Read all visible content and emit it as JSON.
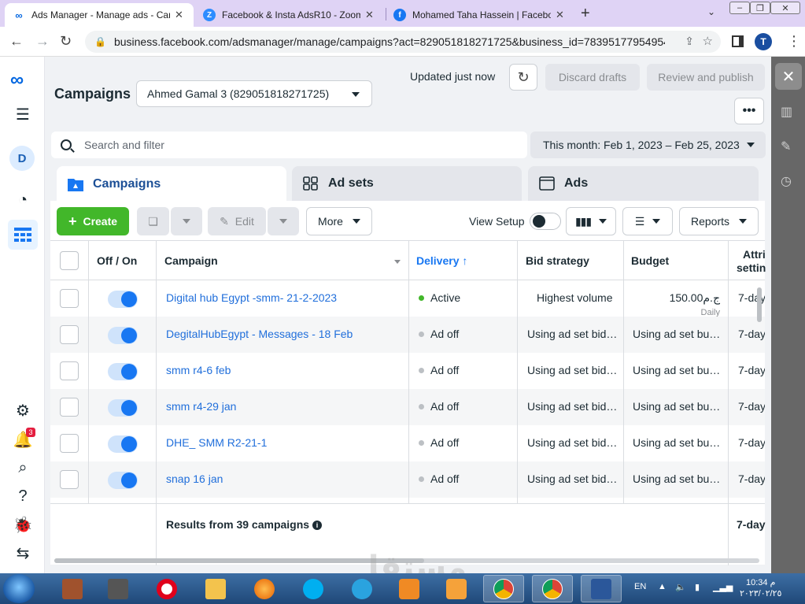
{
  "browser": {
    "tabs": [
      {
        "title": "Ads Manager - Manage ads - Campaigns",
        "active": true
      },
      {
        "title": "Facebook & Insta AdsR10 - Zoom",
        "active": false
      },
      {
        "title": "Mohamed Taha Hassein | Facebook",
        "active": false
      }
    ],
    "url": "business.facebook.com/adsmanager/manage/campaigns?act=829051818271725&business_id=78395177954954...",
    "profile_initial": "T"
  },
  "leftnav": {
    "avatar_initial": "D",
    "notification_count": "3"
  },
  "header": {
    "title": "Campaigns",
    "account": "Ahmed Gamal 3 (829051818271725)",
    "updated": "Updated just now",
    "discard_label": "Discard drafts",
    "review_label": "Review and publish",
    "more_dots": "•••"
  },
  "filters": {
    "search_placeholder": "Search and filter",
    "date_range": "This month: Feb 1, 2023 – Feb 25, 2023"
  },
  "level_tabs": {
    "campaigns": "Campaigns",
    "adsets": "Ad sets",
    "ads": "Ads"
  },
  "toolbar": {
    "create": "Create",
    "edit": "Edit",
    "more": "More",
    "view_setup": "View Setup",
    "reports": "Reports"
  },
  "table": {
    "headers": {
      "onoff": "Off / On",
      "campaign": "Campaign",
      "delivery": "Delivery ↑",
      "bid": "Bid strategy",
      "budget": "Budget",
      "attr1": "Attri",
      "attr2": "settin"
    },
    "rows": [
      {
        "name": "Digital hub Egypt -smm- 21-2-2023",
        "delivery": "Active",
        "status": "active",
        "bid": "Highest volume",
        "budget": "150.00ج.م",
        "budget_sub": "Daily",
        "attr": "7-day"
      },
      {
        "name": "DegitalHubEgypt - Messages - 18 Feb",
        "delivery": "Ad off",
        "status": "off",
        "bid": "Using ad set bid…",
        "budget": "Using ad set bu…",
        "budget_sub": "",
        "attr": "7-day"
      },
      {
        "name": "smm r4-6 feb",
        "delivery": "Ad off",
        "status": "off",
        "bid": "Using ad set bid…",
        "budget": "Using ad set bu…",
        "budget_sub": "",
        "attr": "7-day"
      },
      {
        "name": "smm r4-29 jan",
        "delivery": "Ad off",
        "status": "off",
        "bid": "Using ad set bid…",
        "budget": "Using ad set bu…",
        "budget_sub": "",
        "attr": "7-day"
      },
      {
        "name": "DHE_ SMM R2-21-1",
        "delivery": "Ad off",
        "status": "off",
        "bid": "Using ad set bid…",
        "budget": "Using ad set bu…",
        "budget_sub": "",
        "attr": "7-day"
      },
      {
        "name": "snap 16 jan",
        "delivery": "Ad off",
        "status": "off",
        "bid": "Using ad set bid…",
        "budget": "Using ad set bu…",
        "budget_sub": "",
        "attr": "7-day"
      }
    ],
    "results": "Results from 39 campaigns",
    "footer_attr": "7-day"
  },
  "colors": {
    "active": "#42b72a",
    "off": "#bcc0c4",
    "link": "#216fdb",
    "accent": "#1877f2"
  },
  "watermark": "مستقل",
  "taskbar": {
    "lang": "EN",
    "time": "10:34 م",
    "date": "٢٠٢٣/٠٢/٢٥"
  }
}
